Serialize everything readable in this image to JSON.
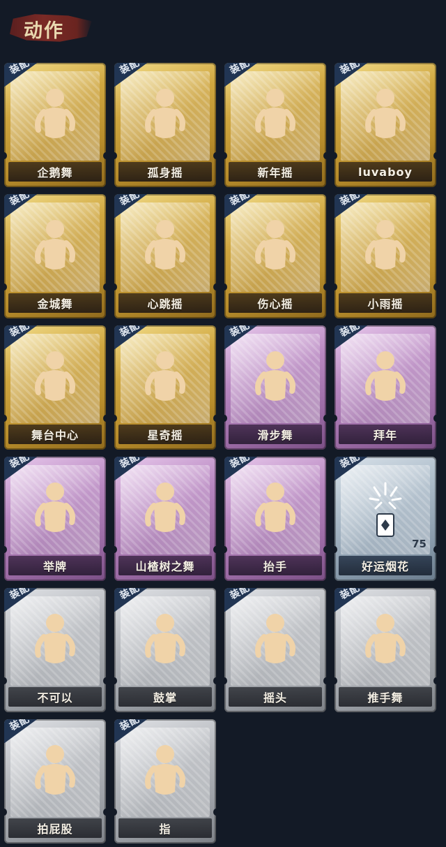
{
  "header": {
    "title": "动作"
  },
  "badge_label": "装配",
  "cards": [
    {
      "label": "企鹅舞",
      "tier": "gold",
      "icon": "dance-pose-icon"
    },
    {
      "label": "孤身摇",
      "tier": "gold",
      "icon": "dance-pose-icon"
    },
    {
      "label": "新年摇",
      "tier": "gold",
      "icon": "dance-pose-icon"
    },
    {
      "label": "luvaboy",
      "tier": "gold",
      "icon": "dance-pose-icon"
    },
    {
      "label": "金城舞",
      "tier": "gold",
      "icon": "dance-pose-icon"
    },
    {
      "label": "心跳摇",
      "tier": "gold",
      "icon": "dance-pose-icon"
    },
    {
      "label": "伤心摇",
      "tier": "gold",
      "icon": "heart-hands-icon"
    },
    {
      "label": "小雨摇",
      "tier": "gold",
      "icon": "dance-pose-icon"
    },
    {
      "label": "舞台中心",
      "tier": "gold",
      "icon": "dance-pose-icon"
    },
    {
      "label": "星奇摇",
      "tier": "gold",
      "icon": "dance-pose-icon"
    },
    {
      "label": "滑步舞",
      "tier": "purple",
      "icon": "dance-pose-icon"
    },
    {
      "label": "拜年",
      "tier": "purple",
      "icon": "greeting-pose-icon"
    },
    {
      "label": "举牌",
      "tier": "purple",
      "icon": "hold-sign-icon"
    },
    {
      "label": "山楂树之舞",
      "tier": "purple",
      "icon": "dance-pose-icon"
    },
    {
      "label": "抬手",
      "tier": "purple",
      "icon": "raise-hand-icon"
    },
    {
      "label": "好运烟花",
      "tier": "blue",
      "icon": "firework-icon",
      "count": "75"
    },
    {
      "label": "不可以",
      "tier": "grey",
      "icon": "finger-wag-icon"
    },
    {
      "label": "鼓掌",
      "tier": "grey",
      "icon": "clap-icon"
    },
    {
      "label": "摇头",
      "tier": "grey",
      "icon": "shake-head-icon"
    },
    {
      "label": "推手舞",
      "tier": "grey",
      "icon": "dance-pose-icon"
    },
    {
      "label": "拍屁股",
      "tier": "grey",
      "icon": "dance-pose-icon"
    },
    {
      "label": "指",
      "tier": "grey",
      "icon": "point-hand-icon"
    }
  ],
  "colors": {
    "background": "#131a26",
    "badge": "#213553",
    "figure": "#f0d3a8"
  }
}
